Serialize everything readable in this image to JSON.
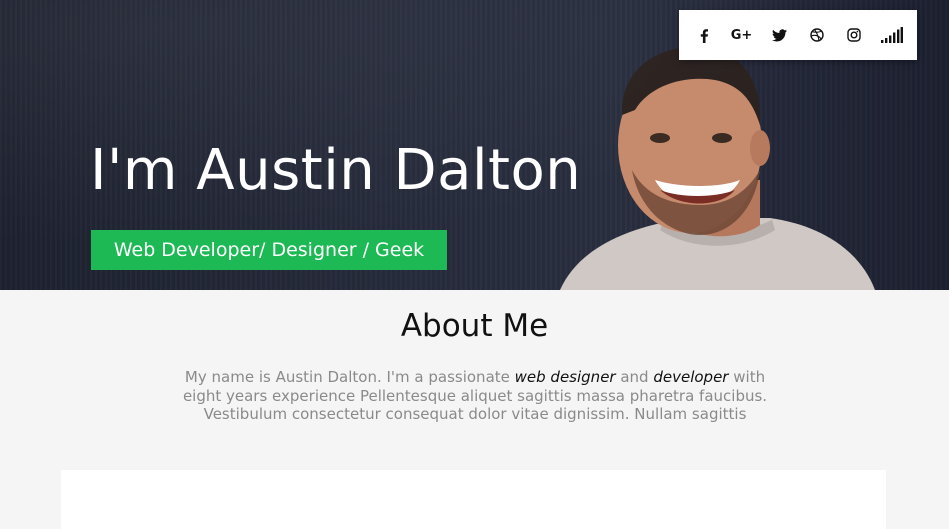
{
  "hero": {
    "title": "I'm Austin Dalton",
    "subtitle": "Web Developer/ Designer / Geek"
  },
  "social": {
    "icons": [
      "facebook-icon",
      "google-plus-icon",
      "twitter-icon",
      "dribbble-icon",
      "instagram-icon",
      "signal-icon"
    ],
    "google_plus_text": "G+"
  },
  "about": {
    "title": "About Me",
    "text_part1": "My name is Austin Dalton. I'm a passionate ",
    "emphasis1": "web designer",
    "text_part2": " and ",
    "emphasis2": "developer",
    "text_part3": " with eight years experience Pellentesque aliquet sagittis massa pharetra faucibus. Vestibulum consectetur consequat dolor vitae dignissim. Nullam sagittis"
  },
  "colors": {
    "accent": "#1db954",
    "hero_background": "#262b3b",
    "page_background": "#f5f5f5"
  }
}
